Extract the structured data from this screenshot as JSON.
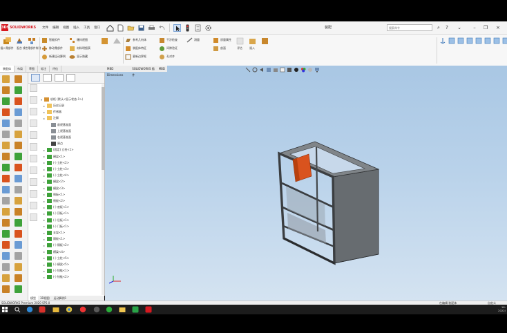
{
  "app": {
    "logo_text": "SOLIDWORKS",
    "doc_title": "装配",
    "search_placeholder": "搜索命令"
  },
  "menu": [
    "文件",
    "编辑",
    "视图",
    "插入",
    "工具",
    "窗口"
  ],
  "ribbon": {
    "big_buttons": [
      "插入零部件",
      "配合",
      "线性零部件阵列"
    ],
    "groups": [
      [
        "智能扣件",
        "移动零部件",
        "新建运动算例"
      ],
      [
        "爆炸视图",
        "材料明细表",
        "显示隐藏"
      ],
      [
        "参考几何体",
        "装配体特征",
        "更新边界框"
      ],
      [
        "干涉检查",
        "间隙验证",
        "孔对齐"
      ],
      [
        "测量",
        "质量属性",
        "剖面"
      ]
    ],
    "right_buttons": [
      "评估",
      "插入"
    ]
  },
  "panel_tabs": [
    "装配体",
    "布局",
    "草图",
    "标注",
    "评估",
    "MBD Dimensions",
    "SOLIDWORKS 插件",
    "MBD"
  ],
  "tree": {
    "root": "机柜 (默认<显示状态-1>)",
    "items": [
      {
        "label": "历史记录",
        "icon": "folder"
      },
      {
        "label": "传感器",
        "icon": "folder"
      },
      {
        "label": "注解",
        "icon": "folder"
      },
      {
        "label": "前视基准面",
        "icon": "plane"
      },
      {
        "label": "上视基准面",
        "icon": "plane"
      },
      {
        "label": "右视基准面",
        "icon": "plane"
      },
      {
        "label": "原点",
        "icon": "origin"
      },
      {
        "label": "(固定) 立柱<1>",
        "icon": "part"
      },
      {
        "label": "横梁<1>",
        "icon": "part"
      },
      {
        "label": "(-) 立柱<2>",
        "icon": "part"
      },
      {
        "label": "(-) 立柱<3>",
        "icon": "part"
      },
      {
        "label": "(-) 立柱<4>",
        "icon": "part"
      },
      {
        "label": "横梁<2>",
        "icon": "part"
      },
      {
        "label": "横梁<3>",
        "icon": "part"
      },
      {
        "label": "侧板<1>",
        "icon": "part"
      },
      {
        "label": "侧板<2>",
        "icon": "part"
      },
      {
        "label": "(-) 底板<1>",
        "icon": "part"
      },
      {
        "label": "(-) 顶板<1>",
        "icon": "part"
      },
      {
        "label": "(-) 后板<1>",
        "icon": "part"
      },
      {
        "label": "(-) 门板<1>",
        "icon": "part"
      },
      {
        "label": "支架<1>",
        "icon": "part"
      },
      {
        "label": "隔板<1>",
        "icon": "part"
      },
      {
        "label": "(-) 隔板<2>",
        "icon": "part"
      },
      {
        "label": "横梁<4>",
        "icon": "part"
      },
      {
        "label": "(-) 立柱<5>",
        "icon": "part"
      },
      {
        "label": "(-) 横梁<5>",
        "icon": "part"
      },
      {
        "label": "(-) 铰链<1>",
        "icon": "part"
      },
      {
        "label": "(-) 铰链<2>",
        "icon": "part"
      }
    ]
  },
  "bottom_tabs": [
    "模型",
    "3D视图",
    "运动算例1"
  ],
  "status": {
    "left": "SOLIDWORKS Premium 2020 SP5.0",
    "mid": "在编辑 装配体",
    "right": "自定义"
  },
  "clock": {
    "time": "16:",
    "date": "2022/"
  },
  "colors": {
    "viewport_top": "#a9c7e4",
    "viewport_bottom": "#d4e3f1",
    "part_gray": "#6f7478",
    "accent_orange": "#d9531e",
    "brand_red": "#d71920",
    "feature_green": "#3ea23a"
  }
}
